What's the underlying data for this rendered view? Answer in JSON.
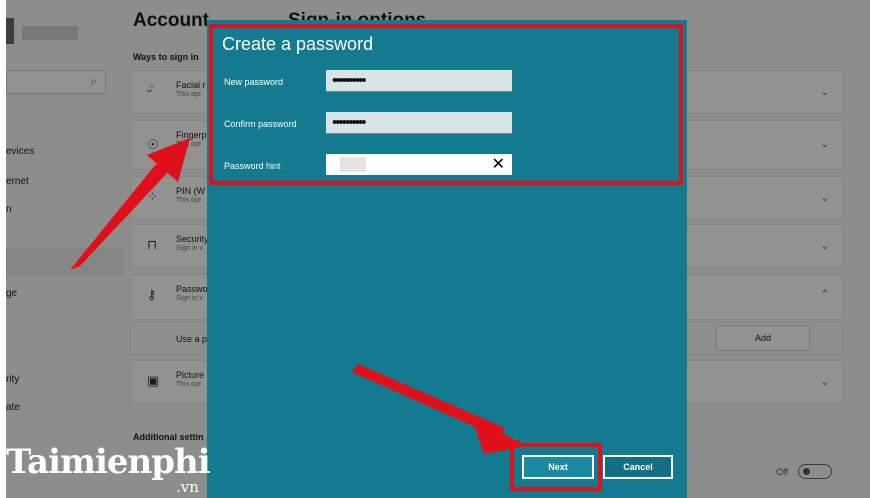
{
  "window": {
    "header_left": "Account",
    "header_right": "Sign-in options",
    "ways_to_sign_in": "Ways to sign in",
    "additional_settings": "Additional settin"
  },
  "nav": {
    "items": [
      {
        "label": "evices"
      },
      {
        "label": "ernet"
      },
      {
        "label": "n"
      },
      {
        "label": "ge"
      },
      {
        "label": "rity"
      },
      {
        "label": "ate"
      }
    ]
  },
  "rows": [
    {
      "icon": "face-icon",
      "glyph": "ᵕ̈",
      "title": "Facial r",
      "sub": "This opt"
    },
    {
      "icon": "fingerprint-icon",
      "glyph": "☉",
      "title": "Fingerp",
      "sub": "This opt"
    },
    {
      "icon": "pin-icon",
      "glyph": "⁘",
      "title": "PIN (W",
      "sub": "This opt"
    },
    {
      "icon": "security-key-icon",
      "glyph": "⊓",
      "title": "Security",
      "sub": "Sign in v"
    },
    {
      "icon": "key-icon",
      "glyph": "⚷",
      "title": "Passwo",
      "sub": "Sign in v"
    },
    {
      "icon": "picture-icon",
      "glyph": "▣",
      "title": "Picture",
      "sub": "This opt"
    }
  ],
  "password_row": {
    "sub_label": "Use a p",
    "add_label": "Add"
  },
  "toggle": {
    "label": "Off"
  },
  "dialog": {
    "title": "Create a password",
    "new_password_label": "New password",
    "new_password_value": "••••••••••",
    "confirm_password_label": "Confirm password",
    "confirm_password_value": "••••••••••",
    "hint_label": "Password hint",
    "hint_value": "",
    "next_label": "Next",
    "cancel_label": "Cancel",
    "color": "#147a8f"
  },
  "watermark": {
    "main": "Taimienphi",
    "suffix": ".vn"
  },
  "colors": {
    "highlight": "#e0101a",
    "dialog": "#147a8f"
  }
}
